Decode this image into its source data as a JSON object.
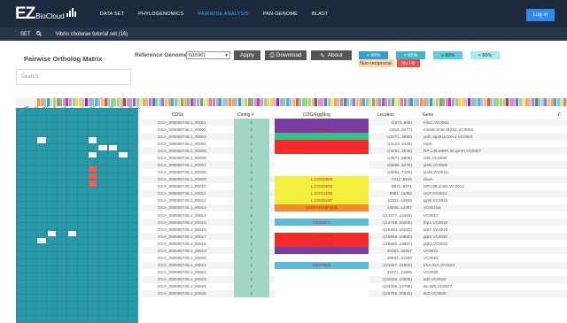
{
  "brand": {
    "ez": "EZ",
    "bio": "BioCloud"
  },
  "nav": [
    "DATA SET",
    "PHYLOGENOMICS",
    "PAIRWISE ANALYSIS",
    "PAN-GENOME",
    "BLAST"
  ],
  "nav_active": 2,
  "login_label": "Log in",
  "setbar": {
    "label": "SET",
    "name": "Vibrio cholerae tutorial set (16)"
  },
  "page_title": "Pairwise Ortholog Matrix",
  "search_placeholder": "Search",
  "reference": {
    "label": "Reference Genome:",
    "value": "N16961"
  },
  "buttons": {
    "apply": "Apply",
    "download": "Download",
    "about": "About"
  },
  "legend": [
    {
      "label": "> 99%",
      "color": "#2f9fca"
    },
    {
      "label": "> 95%",
      "color": "#39b8c6"
    },
    {
      "label": "≥ 80%",
      "color": "#5bd0dc"
    },
    {
      "label": "< 80%",
      "color": "#a8ecf1"
    },
    {
      "label": "Non-reciprocal",
      "color": "#ffd6a6"
    },
    {
      "label": "No Hit",
      "color": "#f54b4b"
    }
  ],
  "columns": {
    "cdss": "CDSs",
    "contig": "Contig #",
    "cog": "COG/EggNog",
    "location": "Location",
    "gene": "Gene",
    "extra": "F"
  },
  "genome_labels": [
    "N16961",
    "TSY216",
    "2012EL-2176",
    "MO10",
    "MZO-2",
    "1587",
    "ATCC 14035",
    "2010EL-1786",
    "O395",
    "TM 11079-80",
    "MJ-1236",
    "LMA3984-4",
    "HE48"
  ],
  "rows": [
    {
      "cds": "GCA_000006745.1_00001",
      "contig": "1",
      "cog": "",
      "cog_color": "#7a3ea1",
      "location": "c(373..906)",
      "gene": "mioC,VC0002"
    },
    {
      "cds": "GCA_000006745.1_00002",
      "contig": "1",
      "cog": "D,COG0486",
      "cog_color": "#7a3ea1",
      "location": "c(916..2277)",
      "gene": "mnmE,trmE,MSS1,VC0003"
    },
    {
      "cds": "GCA_000006745.1_00003",
      "contig": "1",
      "cog": "",
      "cog_color": "#3dbd8a",
      "location": "c(2271..3890)",
      "gene": "yidC,spoIIIJ,OXA1,VC0004"
    },
    {
      "cds": "GCA_000006745.1_00004",
      "contig": "1",
      "cog": "",
      "cog_color": "#f52b2b",
      "location": "c(4123..4446)",
      "gene": "rnpA"
    },
    {
      "cds": "GCA_000006745.1_00005",
      "contig": "1",
      "cog": "",
      "cog_color": "#f52b2b",
      "location": "c(4492..4629)",
      "gene": "RP-L34,MRPL34,rpmH,VC0007"
    },
    {
      "cds": "GCA_000006745.1_00006",
      "contig": "1",
      "cog": "",
      "cog_color": "#ffffff",
      "location": "c(4871..5608)",
      "gene": "orfE,VC0008"
    },
    {
      "cds": "GCA_000006745.1_00007",
      "contig": "1",
      "cog": "",
      "cog_color": "#ffffff",
      "location": "c(5605..6276)",
      "gene": "yieN,VC0009"
    },
    {
      "cds": "GCA_000006745.1_00008",
      "contig": "1",
      "cog": "",
      "cog_color": "#ffffff",
      "location": "c(6554..7100)",
      "gene": "yieM,VC0010"
    },
    {
      "cds": "GCA_000006745.1_00009",
      "contig": "1",
      "cog": "L,COG0593",
      "cog_color": "#f2ee3c",
      "location": "7412..8815",
      "gene": "dnaA"
    },
    {
      "cds": "GCA_000006745.1_00010",
      "contig": "1",
      "cog": "L,COG0592",
      "cog_color": "#f2ee3c",
      "location": "8871..9971",
      "gene": "DPO3B,dnaN,VC0013"
    },
    {
      "cds": "GCA_000006745.1_00011",
      "contig": "1",
      "cog": "L,COG1195",
      "cog_color": "#f2ee3c",
      "location": "9991..11062",
      "gene": "recF,VC0014"
    },
    {
      "cds": "GCA_000006745.1_00012",
      "contig": "1",
      "cog": "L,COG0187",
      "cog_color": "#f2ee3c",
      "location": "11103..13520",
      "gene": "gyrB,VC0015"
    },
    {
      "cds": "GCA_000006745.1_00013",
      "contig": "1",
      "cog": "ENOG4105F1CE",
      "cog_color": "#f28c28",
      "location": "13845..14367",
      "gene": "VC0015a"
    },
    {
      "cds": "GCA_000006745.1_00014",
      "contig": "1",
      "cog": "",
      "cog_color": "#ffffff",
      "location": "c(14377..14493)",
      "gene": "VC0017"
    },
    {
      "cds": "GCA_000006745.1_00015",
      "contig": "1",
      "cog": "COG0071",
      "cog_color": "#5bbcd8",
      "location": "c(14769..15206)",
      "gene": "ibpA,VC0018"
    },
    {
      "cds": "GCA_000006745.1_00016",
      "contig": "1",
      "cog": "",
      "cog_color": "#ffffff",
      "location": "c(15294..16250)",
      "gene": "aotA,VC0019"
    },
    {
      "cds": "GCA_000006745.1_00017",
      "contig": "1",
      "cog": "C,COG0578",
      "cog_color": "#f52b2b",
      "location": "c(15869..18555)",
      "gene": "glpS,VC0020"
    },
    {
      "cds": "GCA_000006745.1_00018",
      "contig": "1",
      "cog": "C,COG0579",
      "cog_color": "#f52b2b",
      "location": "c(18560..19867)",
      "gene": "glpQ,VC0021"
    },
    {
      "cds": "GCA_000006745.1_00019",
      "contig": "1",
      "cog": "COG2512",
      "cog_color": "#7a3ea1",
      "location": "20283..20837",
      "gene": "VC0022"
    },
    {
      "cds": "GCA_000006745.1_00020",
      "contig": "1",
      "cog": "",
      "cog_color": "#ffffff",
      "location": "20843..21200",
      "gene": "VC0023"
    },
    {
      "cds": "GCA_000006745.1_00021",
      "contig": "1",
      "cog": "COG0526",
      "cog_color": "#5bbcd8",
      "location": "c(21267..21500)",
      "gene": "trxA,trxA,VC0024"
    },
    {
      "cds": "GCA_000006745.1_00022",
      "contig": "1",
      "cog": "",
      "cog_color": "#ffffff",
      "location": "21671..21906",
      "gene": "VC0025"
    },
    {
      "cds": "GCA_000006745.1_00023",
      "contig": "1",
      "cog": "",
      "cog_color": "#ffffff",
      "location": "c(22026..23006)",
      "gene": "adh,VC0026"
    },
    {
      "cds": "GCA_000006745.1_00024",
      "contig": "1",
      "cog": "",
      "cog_color": "#ffffff",
      "location": "c(23206..24788)",
      "gene": "ilvI,ilvB,VC0027"
    },
    {
      "cds": "GCA_000006745.1_00025",
      "contig": "1",
      "cog": "",
      "cog_color": "#ffffff",
      "location": "c(24792..26533)",
      "gene": "ilvD,VC0028"
    }
  ]
}
